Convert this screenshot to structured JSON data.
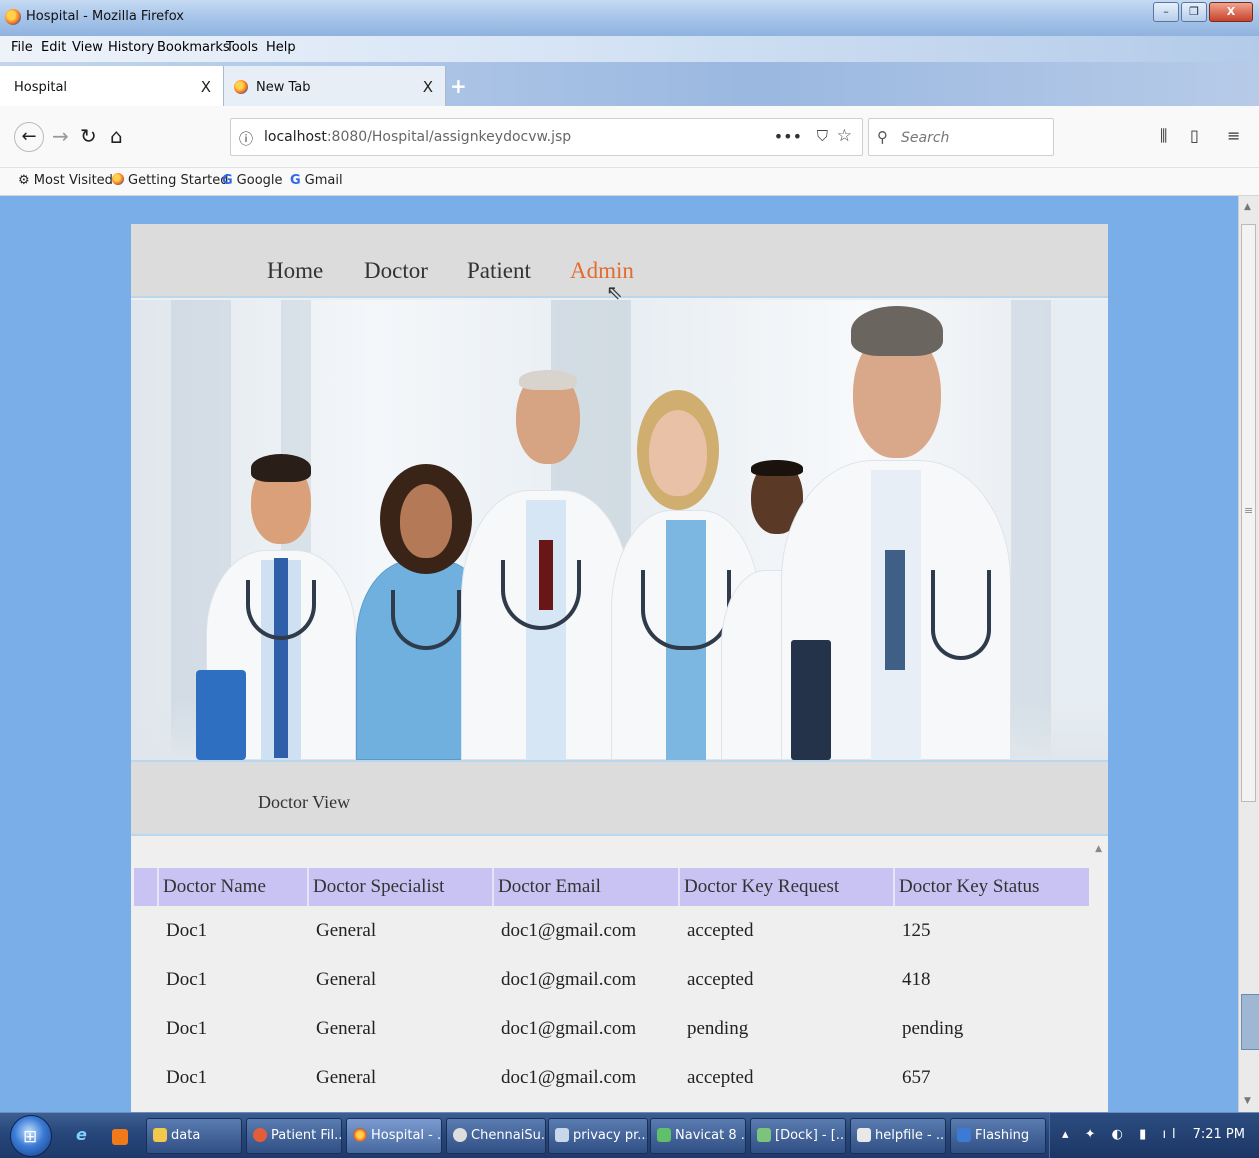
{
  "window": {
    "title": "Hospital - Mozilla Firefox",
    "minimize": "–",
    "maximize": "❐",
    "close": "X"
  },
  "menu": [
    "File",
    "Edit",
    "View",
    "History",
    "Bookmarks",
    "Tools",
    "Help"
  ],
  "tabs": [
    {
      "label": "Hospital",
      "close": "X",
      "active": true
    },
    {
      "label": "New Tab",
      "close": "X",
      "active": false
    }
  ],
  "new_tab_label": "+",
  "nav": {
    "back_icon": "←",
    "forward_icon": "→",
    "reload_icon": "↻",
    "home_icon": "⌂",
    "url_host": "localhost",
    "url_path": ":8080/Hospital/assignkeydocvw.jsp",
    "info_icon": "ⓘ",
    "more_icon": "•••",
    "pocket_icon": "⛉",
    "star_icon": "☆",
    "search_placeholder": "Search",
    "search_icon": "⚲",
    "library_icon": "⫼",
    "sidebar_icon": "▯",
    "menu_icon": "≡"
  },
  "bookmarks": [
    {
      "label": "Most Visited",
      "icon": "gear-icon"
    },
    {
      "label": "Getting Started",
      "icon": "firefox-icon"
    },
    {
      "label": "Google",
      "icon": "google-icon"
    },
    {
      "label": "Gmail",
      "icon": "google-icon"
    }
  ],
  "site": {
    "nav_links": [
      "Home",
      "Doctor",
      "Patient",
      "Admin"
    ],
    "active_link": "Admin",
    "section_title": "Doctor View"
  },
  "table": {
    "headers": [
      "Doctor Name",
      "Doctor Specialist",
      "Doctor Email",
      "Doctor Key Request",
      "Doctor Key Status"
    ],
    "rows": [
      [
        "Doc1",
        "General",
        "doc1@gmail.com",
        "accepted",
        "125"
      ],
      [
        "Doc1",
        "General",
        "doc1@gmail.com",
        "accepted",
        "418"
      ],
      [
        "Doc1",
        "General",
        "doc1@gmail.com",
        "pending",
        "pending"
      ],
      [
        "Doc1",
        "General",
        "doc1@gmail.com",
        "accepted",
        "657"
      ]
    ]
  },
  "taskbar": {
    "buttons": [
      "data",
      "Patient Fil...",
      "Hospital - ...",
      "ChennaiSu...",
      "privacy pr...",
      "Navicat 8 ...",
      "[Dock] - [...",
      "helpfile - ...",
      "Flashing"
    ],
    "clock": "7:21 PM"
  },
  "colors": {
    "accent": "#e36b2e",
    "table_header": "#c8c3f3",
    "page_bg": "#7aaee9"
  }
}
